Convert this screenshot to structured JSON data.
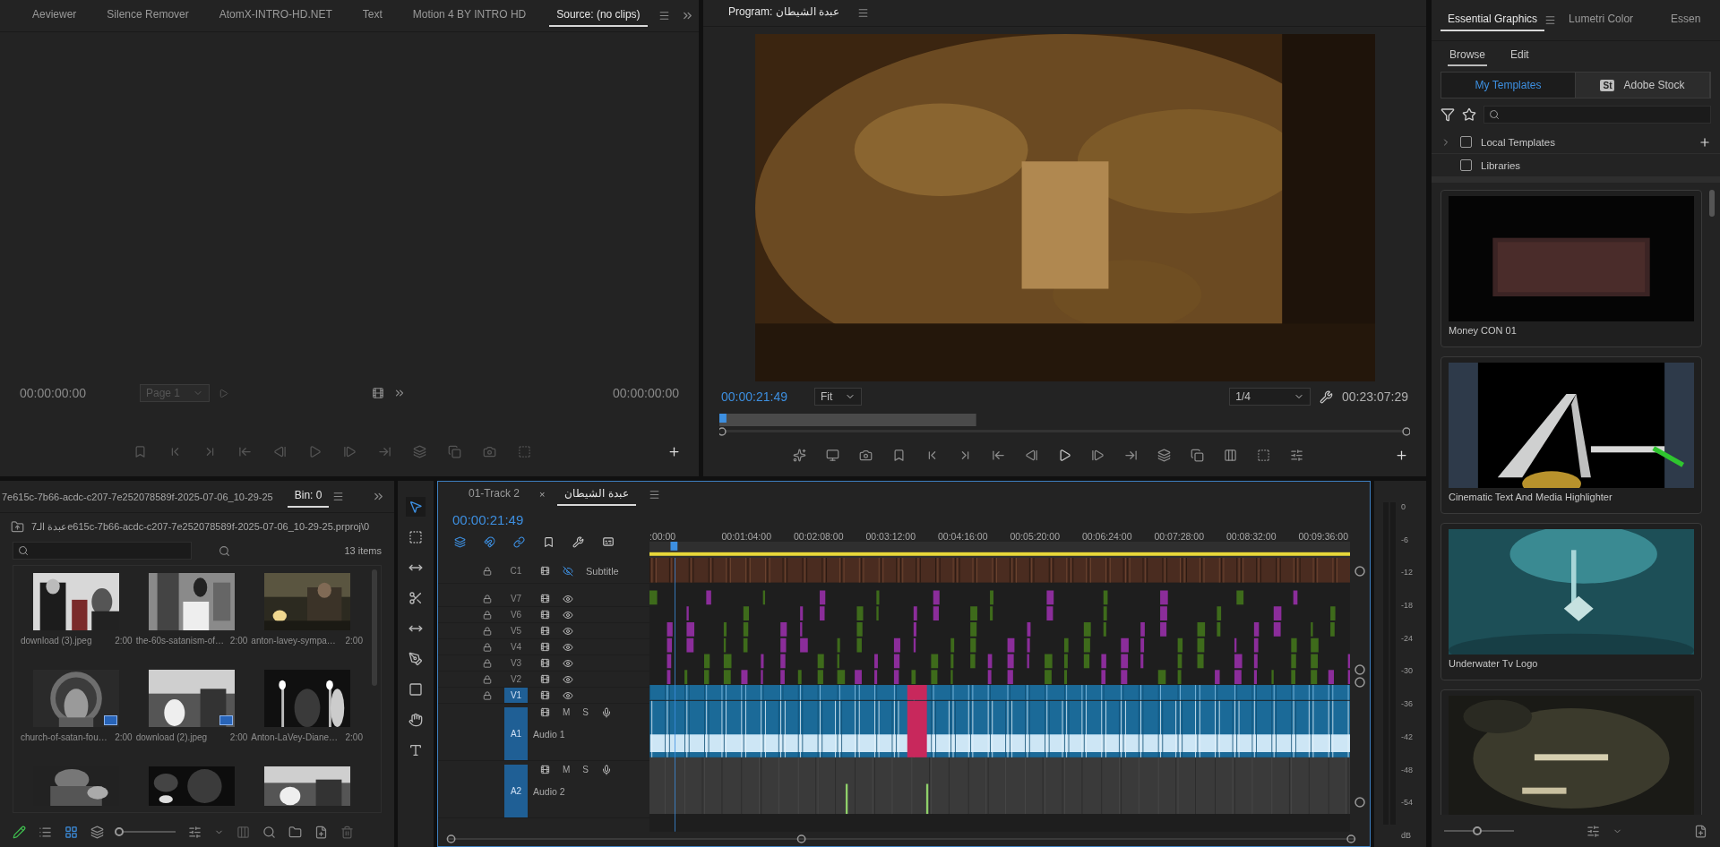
{
  "source_panel": {
    "tabs": [
      {
        "label": "Aeviewer",
        "selected": false
      },
      {
        "label": "Silence Remover",
        "selected": false
      },
      {
        "label": "AtomX-INTRO-HD.NET",
        "selected": false
      },
      {
        "label": "Text",
        "selected": false
      },
      {
        "label": "Motion 4 BY INTRO HD",
        "selected": false
      },
      {
        "label": "Source: (no clips)",
        "selected": true
      }
    ],
    "timecode_in": "00:00:00:00",
    "page": "Page 1",
    "timecode_out": "00:00:00:00"
  },
  "program_monitor": {
    "title": "Program: عبدة الشيطان",
    "timecode": "00:00:21:49",
    "zoom": "Fit",
    "resolution": "1/4",
    "duration": "00:23:07:29"
  },
  "project_panel": {
    "title": "7e615c-7b66-acdc-c207-7e252078589f-2025-07-06_10-29-25",
    "bin_tab": {
      "label": "Bin: 0",
      "selected": true
    },
    "path": "7عبدة الـe615c-7b66-acdc-c207-7e252078589f-2025-07-06_10-29-25.prproj\\0",
    "item_count": "13 items",
    "items": [
      {
        "kind": "clip",
        "name": "download (3).jpeg",
        "duration": "2:00",
        "video_badge": false
      },
      {
        "kind": "clip",
        "name": "the-60s-satanism-of…",
        "duration": "2:00",
        "video_badge": false
      },
      {
        "kind": "clip",
        "name": "anton-lavey-sympa…",
        "duration": "2:00",
        "video_badge": false
      },
      {
        "kind": "clip",
        "name": "church-of-satan-fou…",
        "duration": "2:00",
        "video_badge": true
      },
      {
        "kind": "clip",
        "name": "download (2).jpeg",
        "duration": "2:00",
        "video_badge": true
      },
      {
        "kind": "clip",
        "name": "Anton-LaVey-Diane…",
        "duration": "2:00",
        "video_badge": false
      },
      {
        "kind": "partial"
      },
      {
        "kind": "partial"
      },
      {
        "kind": "partial"
      }
    ],
    "thumb_size": {
      "level": 0.05
    }
  },
  "timeline": {
    "tabs": [
      {
        "label": "01-Track 2",
        "selected": false
      },
      {
        "label": "عبدة الشيطان",
        "selected": true,
        "close": "×"
      }
    ],
    "timecode": "00:00:21:49",
    "ruler": [
      ":00:00",
      "00:01:04:00",
      "00:02:08:00",
      "00:03:12:00",
      "00:04:16:00",
      "00:05:20:00",
      "00:06:24:00",
      "00:07:28:00",
      "00:08:32:00",
      "00:09:36:00"
    ],
    "tracks": [
      {
        "kind": "caption",
        "id": "C1",
        "name": "Subtitle",
        "selected": false
      },
      {
        "kind": "video",
        "id": "V7",
        "selected": false
      },
      {
        "kind": "video",
        "id": "V6",
        "selected": false
      },
      {
        "kind": "video",
        "id": "V5",
        "selected": false
      },
      {
        "kind": "video",
        "id": "V4",
        "selected": false
      },
      {
        "kind": "video",
        "id": "V3",
        "selected": false
      },
      {
        "kind": "video",
        "id": "V2",
        "selected": false
      },
      {
        "kind": "video",
        "id": "V1",
        "selected": true
      },
      {
        "kind": "audio",
        "id": "A1",
        "name": "Audio 1",
        "mute": "M",
        "solo": "S",
        "selected": true
      },
      {
        "kind": "audio",
        "id": "A2",
        "name": "Audio 2",
        "mute": "M",
        "solo": "S",
        "selected": true
      }
    ]
  },
  "audio_meter": {
    "scale": [
      "0",
      "-6",
      "-12",
      "-18",
      "-24",
      "-30",
      "-36",
      "-42",
      "-48",
      "-54"
    ],
    "unit": "dB"
  },
  "essential_graphics": {
    "tabs": [
      {
        "label": "Essential Graphics",
        "selected": true
      },
      {
        "label": "Lumetri Color",
        "selected": false
      },
      {
        "label": "Essen",
        "selected": false
      }
    ],
    "subtabs": [
      {
        "label": "Browse",
        "selected": true
      },
      {
        "label": "Edit",
        "selected": false
      }
    ],
    "sources": [
      {
        "label": "My Templates",
        "selected": true
      },
      {
        "label": "Adobe Stock",
        "badge": "St",
        "selected": false
      }
    ],
    "folders": [
      {
        "label": "Local Templates",
        "expandable": true,
        "checked": false
      },
      {
        "label": "Libraries",
        "expandable": false,
        "checked": false
      }
    ],
    "templates": [
      {
        "kind": "template",
        "name": "Money CON 01"
      },
      {
        "kind": "template",
        "name": "Cinematic Text And Media Highlighter"
      },
      {
        "kind": "template",
        "name": "Underwater Tv Logo"
      },
      {
        "kind": "template"
      }
    ],
    "thumb_size": {
      "level": 0.48
    }
  }
}
